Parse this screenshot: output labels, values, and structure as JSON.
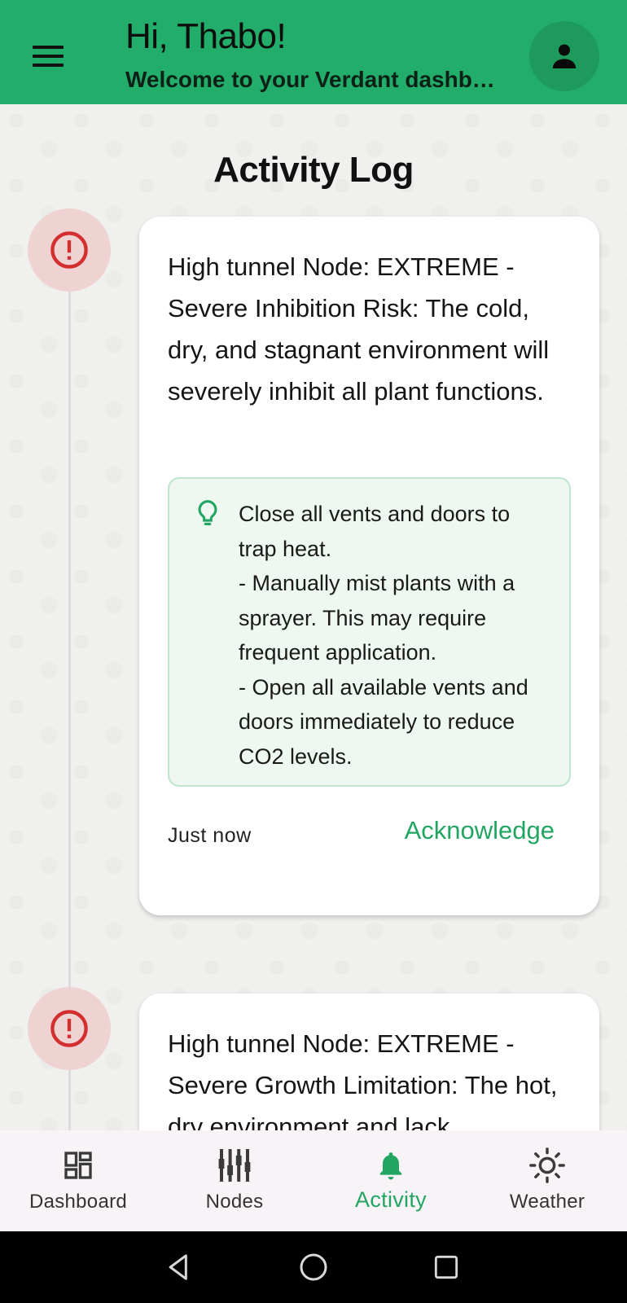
{
  "header": {
    "greeting": "Hi, Thabo!",
    "subtitle": "Welcome to your Verdant dashboard",
    "menu_icon": "hamburger-menu-icon",
    "profile_icon": "person-icon"
  },
  "page": {
    "title": "Activity Log"
  },
  "alerts": [
    {
      "icon": "error-exclamation-icon",
      "title": "High tunnel Node: EXTREME - Severe Inhibition Risk: The cold, dry, and stagnant environment will severely inhibit all plant functions.",
      "tip_icon": "lightbulb-icon",
      "tip": "Close all vents and doors to trap heat.\n- Manually mist plants with a sprayer. This may require frequent application.\n- Open all available vents and doors immediately to reduce CO2 levels.",
      "time": "Just now",
      "action_label": "Acknowledge"
    },
    {
      "icon": "error-exclamation-icon",
      "title": "High tunnel Node: EXTREME - Severe Growth Limitation: The hot, dry environment and lack"
    }
  ],
  "nav": {
    "items": [
      {
        "label": "Dashboard",
        "icon": "dashboard-grid-icon"
      },
      {
        "label": "Nodes",
        "icon": "sliders-icon"
      },
      {
        "label": "Activity",
        "icon": "bell-icon",
        "active": true
      },
      {
        "label": "Weather",
        "icon": "sun-icon"
      }
    ]
  },
  "colors": {
    "primary": "#22ad6a",
    "accent_text": "#22a563",
    "alert_bg": "#efd2d2",
    "alert_icon": "#d32f2f",
    "tip_bg": "#eef8f1",
    "tip_border": "#bfe5cd"
  }
}
